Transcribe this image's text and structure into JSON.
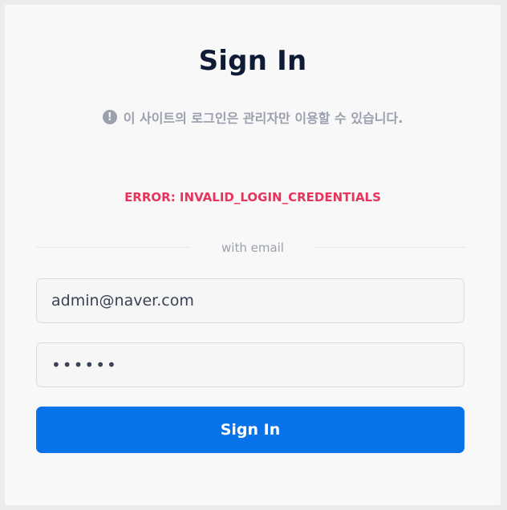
{
  "form": {
    "title": "Sign In",
    "notice_icon": "exclamation-circle-icon",
    "notice_icon_glyph": "!",
    "notice_text": "이 사이트의 로그인은 관리자만 이용할 수 있습니다.",
    "error_text": "ERROR: INVALID_LOGIN_CREDENTIALS",
    "divider_text": "with email",
    "email_value": "admin@naver.com",
    "password_value": "••••••",
    "submit_label": "Sign In"
  },
  "colors": {
    "accent": "#0872e8",
    "error": "#e8335c",
    "title": "#0f1a35",
    "muted": "#9aa0ad",
    "card_background": "#f8f8f8"
  }
}
